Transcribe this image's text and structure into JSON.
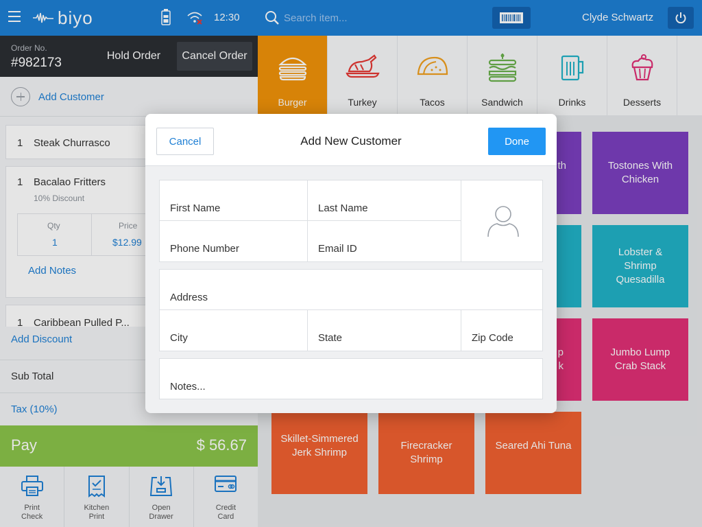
{
  "topbar": {
    "logo": "biyo",
    "time": "12:30"
  },
  "order": {
    "label": "Order No.",
    "number": "#982173",
    "hold_label": "Hold Order",
    "cancel_label": "Cancel Order"
  },
  "customer": {
    "add_label": "Add Customer"
  },
  "items": [
    {
      "qty": "1",
      "name": "Steak Churrasco"
    },
    {
      "qty": "1",
      "name": "Bacalao Fritters",
      "discount": "10% Discount",
      "qty_header": "Qty",
      "qty_value": "1",
      "price_header": "Price",
      "price_value": "$12.99",
      "notes_label": "Add Notes"
    },
    {
      "qty": "1",
      "name": "Caribbean Pulled P..."
    }
  ],
  "totals": {
    "add_discount": "Add Discount",
    "subtotal_label": "Sub Total",
    "tax_label": "Tax (10%)"
  },
  "pay": {
    "label": "Pay",
    "amount": "$ 56.67"
  },
  "actions": [
    {
      "label": "Print\nCheck",
      "icon": "printer-icon"
    },
    {
      "label": "Kitchen\nPrint",
      "icon": "receipt-icon"
    },
    {
      "label": "Open\nDrawer",
      "icon": "drawer-icon"
    },
    {
      "label": "Credit\nCard",
      "icon": "credit-card-icon"
    }
  ],
  "search": {
    "placeholder": "Search item..."
  },
  "user": {
    "name": "Clyde Schwartz"
  },
  "categories": [
    {
      "label": "Burger",
      "icon": "burger-icon",
      "active": true
    },
    {
      "label": "Turkey",
      "icon": "turkey-icon"
    },
    {
      "label": "Tacos",
      "icon": "taco-icon"
    },
    {
      "label": "Sandwich",
      "icon": "sandwich-icon"
    },
    {
      "label": "Drinks",
      "icon": "mug-icon"
    },
    {
      "label": "Desserts",
      "icon": "cupcake-icon"
    }
  ],
  "tiles": {
    "partial_1": "th",
    "partial_2": "p\nk",
    "tostones": "Tostones With\nChicken",
    "lobster": "Lobster &\nShrimp\nQuesadilla",
    "jumbo": "Jumbo Lump\nCrab Stack",
    "skillet": "Skillet-Simmered\nJerk Shrimp",
    "firecracker": "Firecracker\nShrimp",
    "seared": "Seared Ahi Tuna"
  },
  "modal": {
    "cancel_label": "Cancel",
    "title": "Add New Customer",
    "done_label": "Done",
    "first_name_placeholder": "First Name",
    "last_name_placeholder": "Last Name",
    "phone_placeholder": "Phone Number",
    "email_placeholder": "Email ID",
    "address_placeholder": "Address",
    "city_placeholder": "City",
    "state_placeholder": "State",
    "zip_placeholder": "Zip Code",
    "notes_placeholder": "Notes..."
  },
  "colors": {
    "brand_blue": "#1e7fd4",
    "dark_bar": "#2b2e33",
    "pay_green": "#8bc34a",
    "category_active": "#f0920a",
    "tile_purple": "#7b3fbf",
    "tile_teal": "#21b2c7",
    "tile_pink": "#e02f75",
    "tile_orange": "#f06030",
    "done_blue": "#2196f3"
  }
}
